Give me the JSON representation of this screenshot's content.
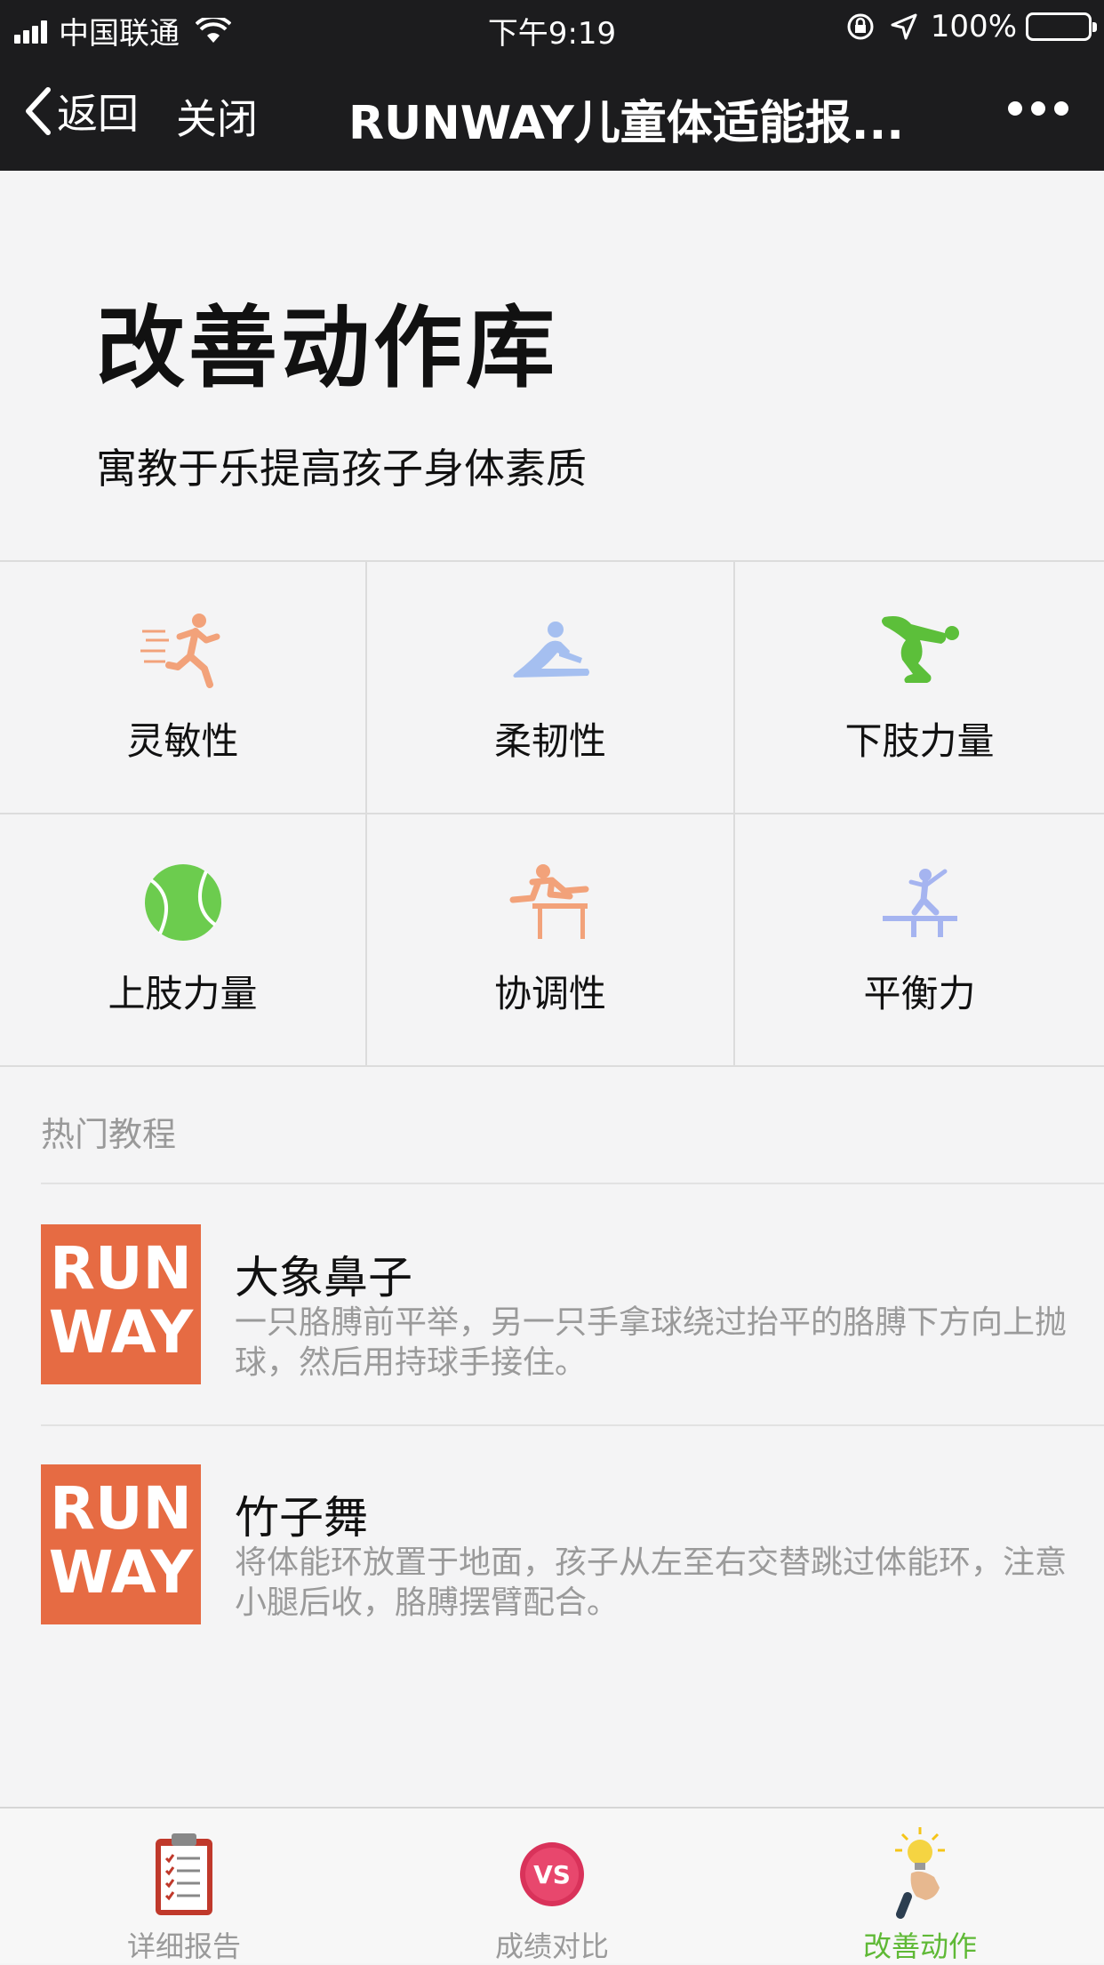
{
  "status_bar": {
    "carrier": "中国联通",
    "time": "下午9:19",
    "battery": "100%"
  },
  "nav": {
    "back_label": "返回",
    "close_label": "关闭",
    "title": "RUNWAY儿童体适能报..."
  },
  "hero": {
    "title": "改善动作库",
    "subtitle": "寓教于乐提高孩子身体素质"
  },
  "categories": [
    {
      "label": "灵敏性",
      "icon": "running-person-icon",
      "color": "#f2a27a"
    },
    {
      "label": "柔韧性",
      "icon": "stretching-person-icon",
      "color": "#a5bff0"
    },
    {
      "label": "下肢力量",
      "icon": "squatting-person-icon",
      "color": "#5cbf3a"
    },
    {
      "label": "上肢力量",
      "icon": "tennis-ball-icon",
      "color": "#6ccc4e"
    },
    {
      "label": "协调性",
      "icon": "hurdle-jump-icon",
      "color": "#f2a27a"
    },
    {
      "label": "平衡力",
      "icon": "balance-beam-icon",
      "color": "#a5b4f0"
    }
  ],
  "popular": {
    "section_title": "热门教程",
    "items": [
      {
        "thumb_line1": "RUN",
        "thumb_line2": "WAY",
        "title": "大象鼻子",
        "description": "一只胳膊前平举，另一只手拿球绕过抬平的胳膊下方向上抛球，然后用持球手接住。"
      },
      {
        "thumb_line1": "RUN",
        "thumb_line2": "WAY",
        "title": "竹子舞",
        "description": "将体能环放置于地面，孩子从左至右交替跳过体能环，注意小腿后收，胳膊摆臂配合。"
      }
    ]
  },
  "tabbar": {
    "tabs": [
      {
        "label": "详细报告",
        "icon": "clipboard-icon"
      },
      {
        "label": "成绩对比",
        "icon": "vs-badge-icon"
      },
      {
        "label": "改善动作",
        "icon": "lightbulb-hand-icon",
        "active": true
      }
    ],
    "active_color": "#5fb936"
  }
}
